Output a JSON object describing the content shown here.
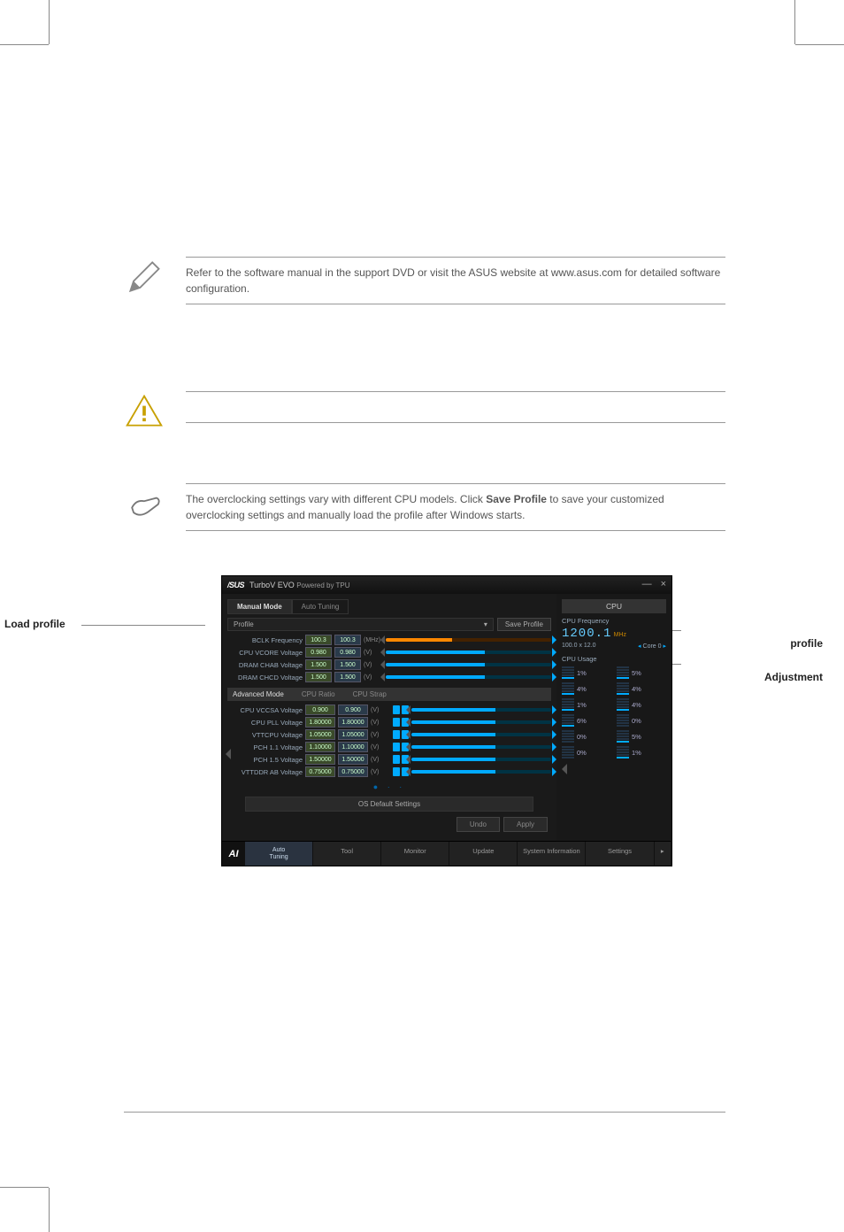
{
  "notes": {
    "pencil": "Refer to the software manual in the support DVD or visit the ASUS website at www.asus.com for detailed software configuration.",
    "hand_prefix": "The overclocking settings vary with different CPU models. Click ",
    "hand_bold": "Save Profile",
    "hand_suffix": " to save your customized overclocking settings and manually load the profile after Windows starts."
  },
  "labels": {
    "load_profile": "Load profile",
    "save_profile_r": "profile",
    "adjustment": "Adjustment"
  },
  "app": {
    "title_brand": "/SUS",
    "title_name": "TurboV EVO",
    "title_sub": "Powered by TPU",
    "win_min": "—",
    "win_close": "×",
    "tab_manual": "Manual Mode",
    "tab_auto": "Auto Tuning",
    "profile_label": "Profile",
    "profile_arrow": "▾",
    "save_profile": "Save Profile",
    "rows": [
      {
        "name": "BCLK Frequency",
        "v1": "100.3",
        "v2": "100.3",
        "unit": "(MHz)",
        "slider": "orange"
      },
      {
        "name": "CPU VCORE Voltage",
        "v1": "0.980",
        "v2": "0.980",
        "unit": "(V)",
        "slider": "blue"
      },
      {
        "name": "DRAM CHAB Voltage",
        "v1": "1.500",
        "v2": "1.500",
        "unit": "(V)",
        "slider": "blue"
      },
      {
        "name": "DRAM CHCD Voltage",
        "v1": "1.500",
        "v2": "1.500",
        "unit": "(V)",
        "slider": "blue"
      }
    ],
    "adv_head": "Advanced Mode",
    "adv_sub1": "CPU Ratio",
    "adv_sub2": "CPU Strap",
    "adv": [
      {
        "name": "CPU VCCSA Voltage",
        "v1": "0.900",
        "v2": "0.900",
        "unit": "(V)"
      },
      {
        "name": "CPU PLL Voltage",
        "v1": "1.80000",
        "v2": "1.80000",
        "unit": "(V)"
      },
      {
        "name": "VTTCPU Voltage",
        "v1": "1.05000",
        "v2": "1.05000",
        "unit": "(V)"
      },
      {
        "name": "PCH 1.1 Voltage",
        "v1": "1.10000",
        "v2": "1.10000",
        "unit": "(V)"
      },
      {
        "name": "PCH 1.5 Voltage",
        "v1": "1.50000",
        "v2": "1.50000",
        "unit": "(V)"
      },
      {
        "name": "VTTDDR AB Voltage",
        "v1": "0.75000",
        "v2": "0.75000",
        "unit": "(V)"
      }
    ],
    "dots": "● · ·",
    "os_default": "OS Default Settings",
    "undo": "Undo",
    "apply": "Apply",
    "bottom": {
      "auto1": "Auto",
      "auto2": "Tuning",
      "tool": "Tool",
      "monitor": "Monitor",
      "update": "Update",
      "sysinfo": "System Information",
      "settings": "Settings"
    },
    "cpu": {
      "head": "CPU",
      "freq_label": "CPU Frequency",
      "freq_val": "1200.1",
      "freq_unit": "MHz",
      "sub_left": "100.0 x 12.0",
      "sub_right": "Core 0",
      "usage_label": "CPU Usage",
      "usages": [
        "1%",
        "5%",
        "4%",
        "4%",
        "1%",
        "4%",
        "6%",
        "0%",
        "0%",
        "5%",
        "0%",
        "1%"
      ]
    }
  }
}
